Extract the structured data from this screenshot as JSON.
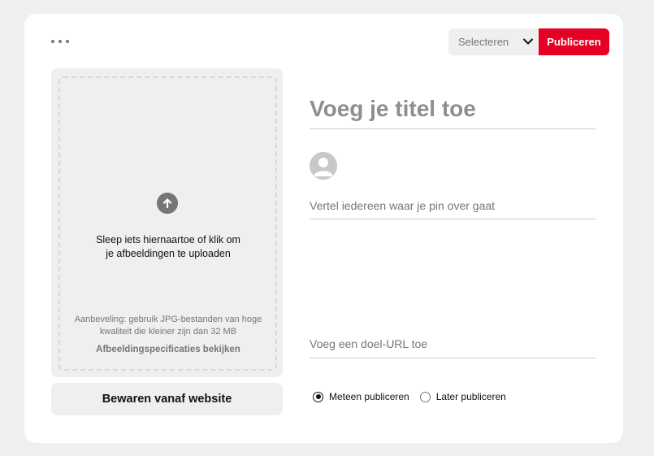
{
  "header": {
    "more_icon": "ellipsis-icon",
    "board_select": {
      "selected": "Selecteren",
      "icon": "chevron-down-icon"
    },
    "publish_label": "Publiceren",
    "publish_color": "#e60023"
  },
  "upload": {
    "icon": "arrow-up-circle-icon",
    "instruction_line1": "Sleep iets hiernaartoe of klik om",
    "instruction_line2": "je afbeeldingen te uploaden",
    "recommend_line1": "Aanbeveling: gebruik JPG-bestanden van hoge",
    "recommend_line2": "kwaliteit die kleiner zijn dan 32 MB",
    "spec_link": "Afbeeldingspecificaties bekijken"
  },
  "save_from_site_label": "Bewaren vanaf website",
  "form": {
    "title_placeholder": "Voeg je titel toe",
    "avatar_icon": "user-avatar-icon",
    "description_placeholder": "Vertel iedereen waar je pin over gaat",
    "url_placeholder": "Voeg een doel-URL toe"
  },
  "publish_timing": {
    "options": [
      {
        "label": "Meteen publiceren",
        "checked": true
      },
      {
        "label": "Later publiceren",
        "checked": false
      }
    ]
  }
}
